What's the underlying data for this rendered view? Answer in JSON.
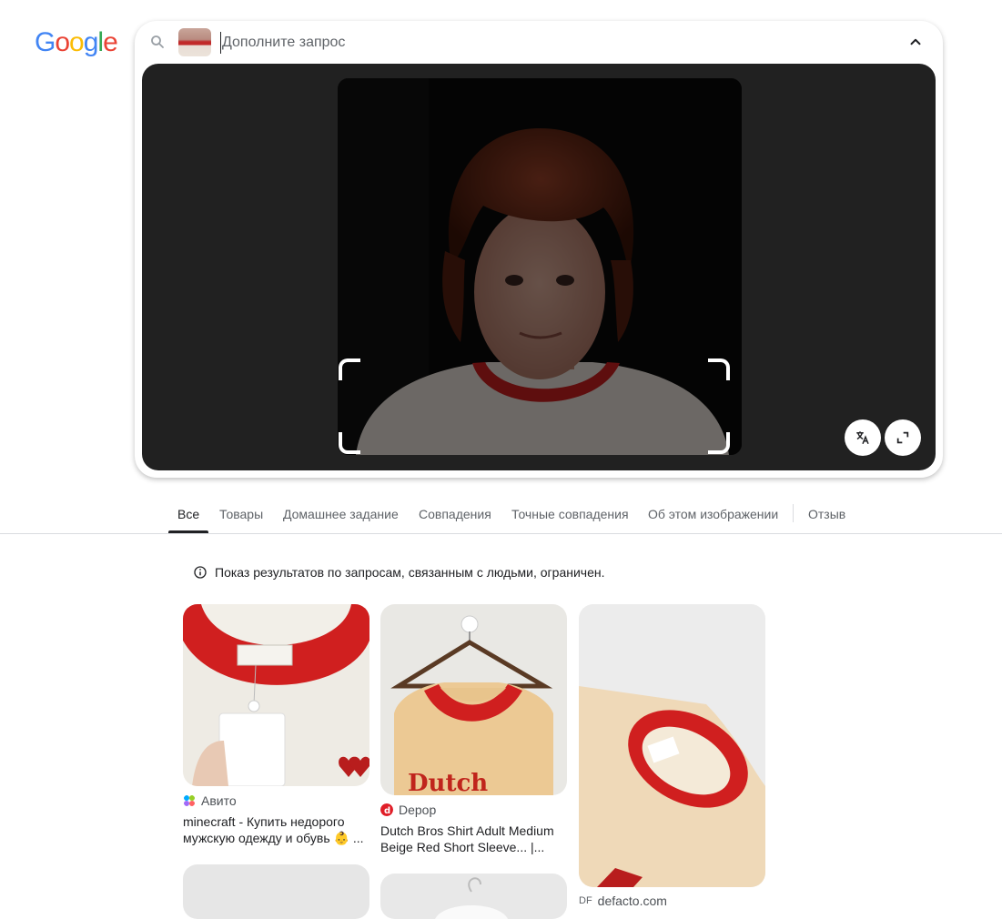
{
  "logo": {
    "text": "Google",
    "letters": [
      "G",
      "o",
      "o",
      "g",
      "l",
      "e"
    ]
  },
  "search": {
    "placeholder": "Дополните запрос"
  },
  "tabs": [
    {
      "label": "Все",
      "active": true
    },
    {
      "label": "Товары"
    },
    {
      "label": "Домашнее задание"
    },
    {
      "label": "Совпадения"
    },
    {
      "label": "Точные совпадения"
    },
    {
      "label": "Об этом изображении"
    },
    {
      "label": "Отзыв"
    }
  ],
  "notice": "Показ результатов по запросам, связанным с людьми, ограничен.",
  "results": [
    {
      "source": "Авито",
      "title_line1": "minecraft - Купить недорого",
      "title_line2": "мужскую одежду и обувь 👶 ..."
    },
    {
      "source": "Depop",
      "title_line1": "Dutch Bros Shirt Adult Medium",
      "title_line2": "Beige Red Short Sleeve... |..."
    },
    {
      "source": "defacto.com",
      "favicon_text": "DF"
    }
  ],
  "colors": {
    "accent_red": "#d01f1f",
    "viewer_bg": "#212121",
    "tab_text": "#5f6368"
  }
}
